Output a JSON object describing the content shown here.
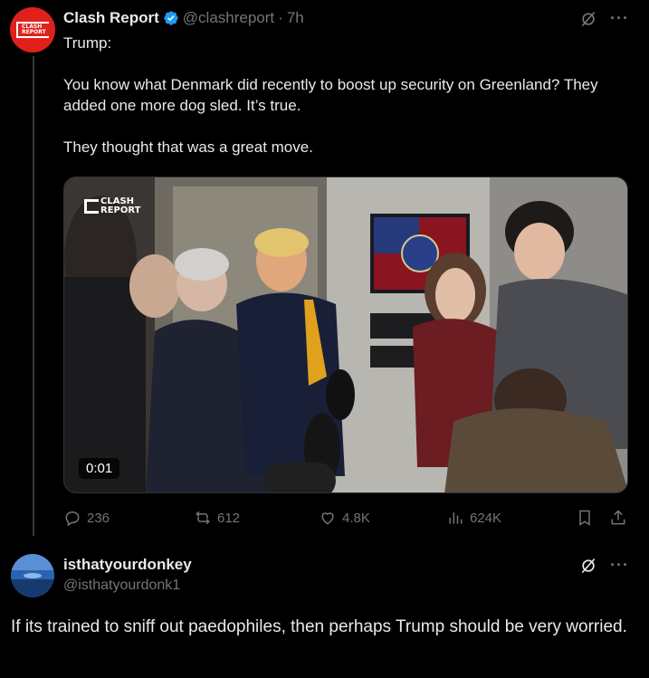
{
  "tweet": {
    "author_name": "Clash Report",
    "author_handle": "@clashreport",
    "time": "7h",
    "text": "Trump:\n\nYou know what Denmark did recently to boost up security on Greenland? They added one more dog sled. It’s true.\n\nThey thought that was a great move.",
    "avatar_text_line1": "CLASH",
    "avatar_text_line2": "REPORT",
    "media": {
      "watermark_line1": "CLASH",
      "watermark_line2": "REPORT",
      "duration": "0:01"
    },
    "actions": {
      "replies": "236",
      "reposts": "612",
      "likes": "4.8K",
      "views": "624K"
    }
  },
  "reply": {
    "author_name": "isthatyourdonkey",
    "author_handle": "@isthatyourdonk1",
    "text": "If its trained to sniff out paedophiles, then perhaps Trump should be very worried."
  },
  "colors": {
    "background": "#000000",
    "text": "#e7e9ea",
    "muted": "#71767b",
    "verified": "#1d9bf0",
    "brand_red": "#e0211b"
  },
  "icons": [
    "verified-badge-icon",
    "grok-icon",
    "more-icon",
    "reply-icon",
    "repost-icon",
    "like-icon",
    "views-icon",
    "bookmark-icon",
    "share-icon"
  ]
}
